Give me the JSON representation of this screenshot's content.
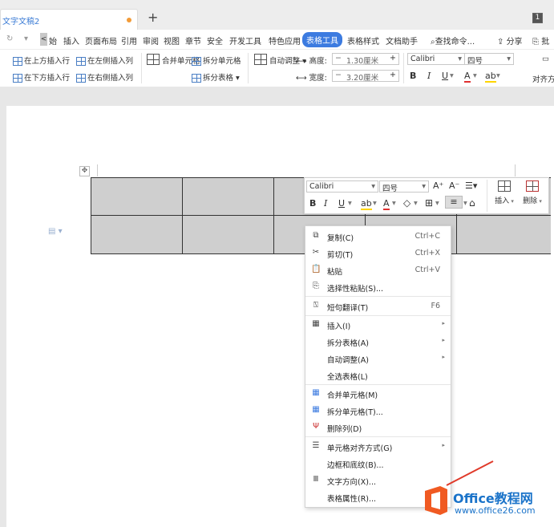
{
  "tabbar": {
    "doc_title": "文字文稿2",
    "new_tab": "+",
    "window_count": "1"
  },
  "menu": {
    "nav_back": "<",
    "items": [
      "始",
      "插入",
      "页面布局",
      "引用",
      "审阅",
      "视图",
      "章节",
      "安全",
      "开发工具",
      "特色应用",
      "表格工具",
      "表格样式",
      "文档助手"
    ],
    "active": "表格工具",
    "search": "查找命令...",
    "share": "分享",
    "comment": "批"
  },
  "ribbon": {
    "insert_above": "在上方插入行",
    "insert_left": "在左侧插入列",
    "insert_below": "在下方插入行",
    "insert_right": "在右侧插入列",
    "merge_cells": "合并单元格",
    "split_cells": "拆分单元格",
    "split_table": "拆分表格",
    "auto_fit": "自动调整",
    "height_label": "高度:",
    "height_value": "1.30厘米",
    "width_label": "宽度:",
    "width_value": "3.20厘米",
    "minus": "−",
    "plus": "+",
    "font": "Calibri",
    "size": "四号",
    "bold": "B",
    "italic": "I",
    "underline": "U",
    "font_color": "A",
    "align": "对齐方"
  },
  "minibar": {
    "font": "Calibri",
    "size": "四号",
    "grow": "A⁺",
    "shrink": "A⁻",
    "bold": "B",
    "italic": "I",
    "underline": "U",
    "insert": "插入",
    "delete": "删除"
  },
  "context_menu": [
    {
      "label": "复制(C)",
      "shortcut": "Ctrl+C",
      "icon": "copy-icon"
    },
    {
      "label": "剪切(T)",
      "shortcut": "Ctrl+X",
      "icon": "cut-icon"
    },
    {
      "label": "粘贴",
      "shortcut": "Ctrl+V",
      "icon": "paste-icon"
    },
    {
      "label": "选择性粘贴(S)...",
      "shortcut": "",
      "icon": "paste-special-icon"
    },
    {
      "label": "短句翻译(T)",
      "shortcut": "F6",
      "icon": "translate-icon"
    },
    {
      "label": "插入(I)",
      "shortcut": "",
      "icon": "table-icon",
      "submenu": true
    },
    {
      "label": "拆分表格(A)",
      "shortcut": "",
      "icon": "",
      "submenu": true
    },
    {
      "label": "自动调整(A)",
      "shortcut": "",
      "icon": "",
      "submenu": true
    },
    {
      "label": "全选表格(L)",
      "shortcut": "",
      "icon": ""
    },
    {
      "label": "合并单元格(M)",
      "shortcut": "",
      "icon": "merge-cells-icon"
    },
    {
      "label": "拆分单元格(T)...",
      "shortcut": "",
      "icon": "split-cells-icon"
    },
    {
      "label": "删除列(D)",
      "shortcut": "",
      "icon": "delete-column-icon"
    },
    {
      "label": "单元格对齐方式(G)",
      "shortcut": "",
      "icon": "cell-align-icon",
      "submenu": true
    },
    {
      "label": "边框和底纹(B)...",
      "shortcut": "",
      "icon": ""
    },
    {
      "label": "文字方向(X)...",
      "shortcut": "",
      "icon": "text-direction-icon"
    },
    {
      "label": "表格属性(R)...",
      "shortcut": "",
      "icon": ""
    }
  ],
  "watermark": {
    "brand": "Office教程网",
    "url": "www.office26.com"
  },
  "colors": {
    "accent": "#3c7be0",
    "cell_fill": "#cfcfcf",
    "logo_orange": "#f05a22"
  }
}
